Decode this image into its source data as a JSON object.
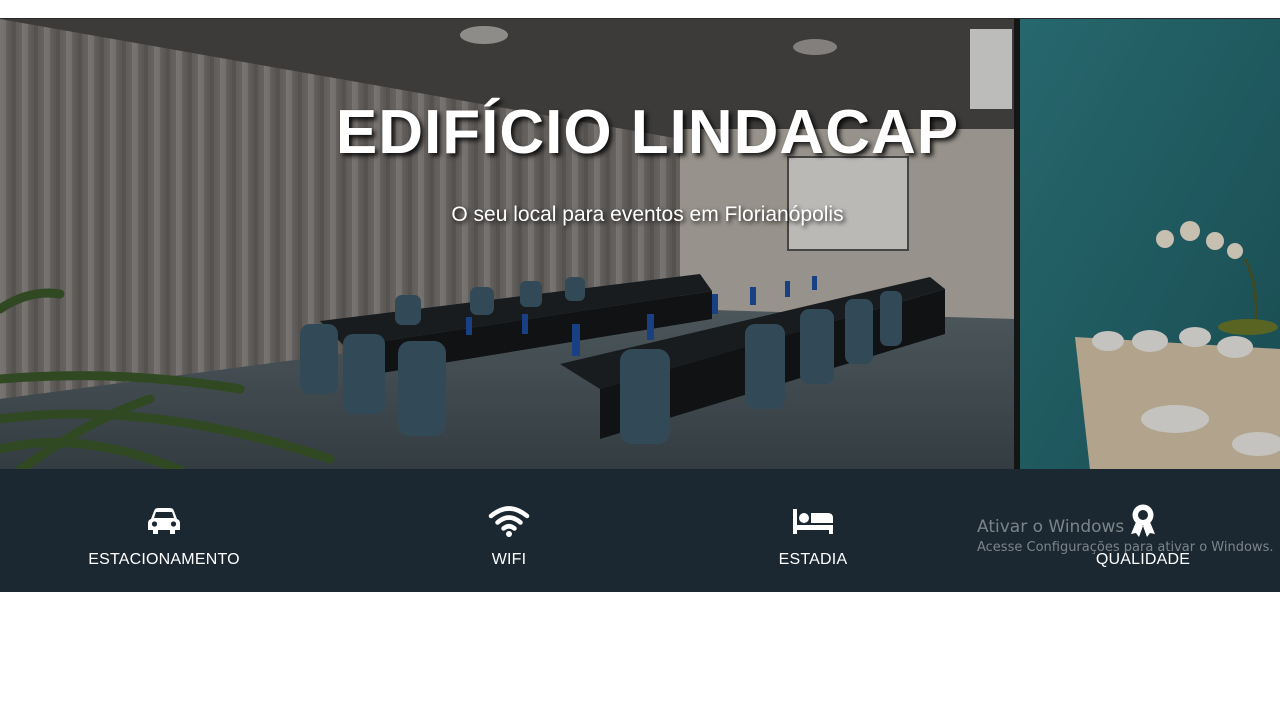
{
  "hero": {
    "title": "EDIFÍCIO LINDACAP",
    "subtitle": "O seu local para eventos em Florianópolis"
  },
  "features": [
    {
      "icon": "car-icon",
      "label": "ESTACIONAMENTO"
    },
    {
      "icon": "wifi-icon",
      "label": "WIFI"
    },
    {
      "icon": "bed-icon",
      "label": "ESTADIA"
    },
    {
      "icon": "award-icon",
      "label": "QUALIDADE"
    }
  ],
  "watermark": {
    "title": "Ativar o Windows",
    "subtitle": "Acesse Configurações para ativar o Windows."
  },
  "colors": {
    "features_bar": "#1b2831",
    "text": "#ffffff"
  }
}
